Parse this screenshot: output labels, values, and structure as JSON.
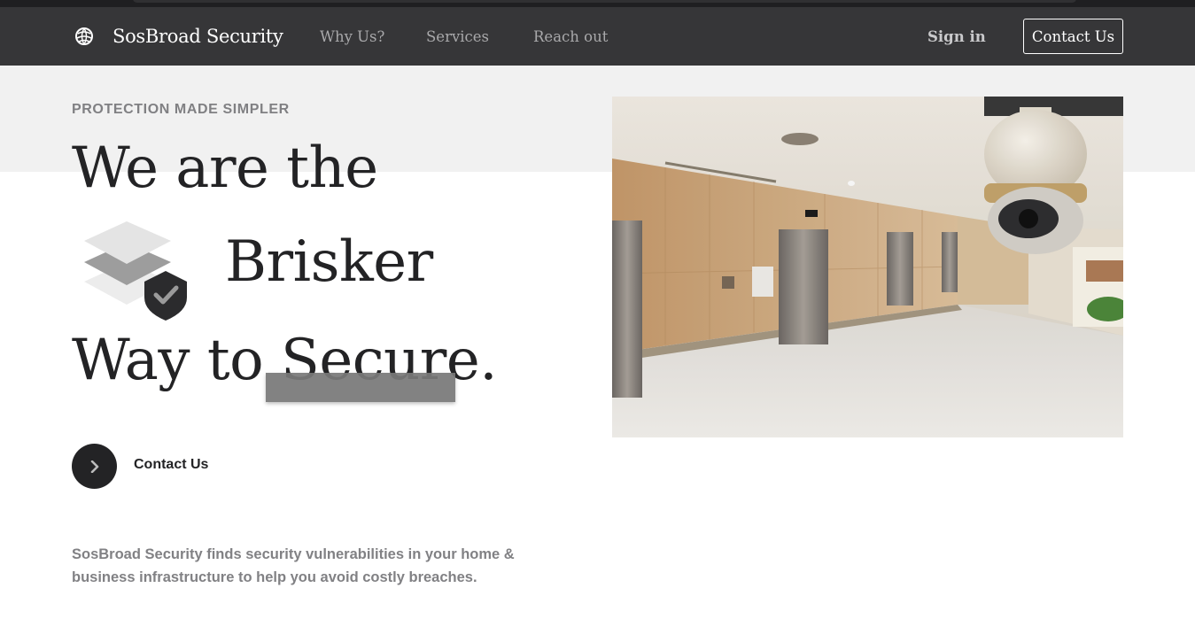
{
  "nav": {
    "brand_name": "SosBroad Security",
    "links": [
      "Why Us?",
      "Services",
      "Reach out"
    ],
    "sign_in": "Sign in",
    "contact_button": "Contact Us"
  },
  "hero": {
    "eyebrow": "PROTECTION MADE SIMPLER",
    "headline_line1": "We are the",
    "headline_line2": "Brisker",
    "headline_line3": "Way to Secure.",
    "cta_label": "Contact Us",
    "description": "SosBroad Security finds security vulnerabilities in your home & business infrastructure to help you avoid costly breaches."
  },
  "icons": {
    "brand": "globe-logo-icon",
    "hero_graphic": "stacked-layers-shield-check-icon",
    "cta": "chevron-right-icon"
  },
  "colors": {
    "navbar_bg": "#363638",
    "hero_band_bg": "#f1f1f1",
    "text_dark": "#232325",
    "text_muted": "#808083"
  }
}
